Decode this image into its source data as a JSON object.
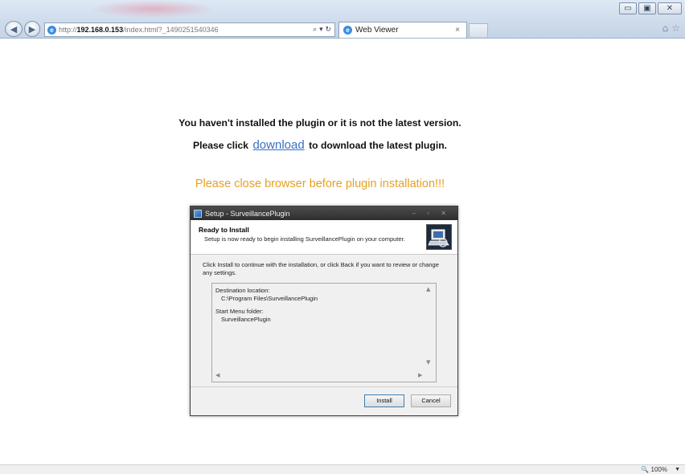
{
  "browser": {
    "window_controls": {
      "minimize": "▭",
      "maximize": "▣",
      "close": "✕"
    },
    "nav": {
      "back_icon": "◀",
      "forward_icon": "▶"
    },
    "address": {
      "protocol": "http://",
      "host": "192.168.0.153",
      "path": "/index.html?_1490251540346",
      "tools": "⌕ ▾ ↻"
    },
    "tab": {
      "title": "Web Viewer",
      "close": "×"
    },
    "right_icons": {
      "home": "⌂",
      "favorites": "☆"
    }
  },
  "page": {
    "line1": "You haven't installed the plugin or it is not the latest version.",
    "line2_before": "Please click",
    "download_link": "download",
    "line2_after": "to download the latest plugin.",
    "warning": "Please close browser before plugin installation!!!"
  },
  "dialog": {
    "title": "Setup - SurveillancePlugin",
    "title_controls": "– ▫ ✕",
    "heading": "Ready to Install",
    "subheading": "Setup is now ready to begin installing SurveillancePlugin on your computer.",
    "body": "Click Install to continue with the installation, or click Back if you want to review or change any settings.",
    "info": {
      "dest_label": "Destination location:",
      "dest_value": "C:\\Program Files\\SurveillancePlugin",
      "menu_label": "Start Menu folder:",
      "menu_value": "SurveillancePlugin"
    },
    "scroll": {
      "up": "▲",
      "down": "▼",
      "left": "◀",
      "right": "▶"
    },
    "buttons": {
      "install": "Install",
      "cancel": "Cancel"
    }
  },
  "status": {
    "zoom": "🔍 100%",
    "zoom_dropdown": "▼"
  },
  "colors": {
    "link": "#3a6fc4",
    "warning": "#e8a020",
    "dialog_title": "#3c3c3c"
  }
}
